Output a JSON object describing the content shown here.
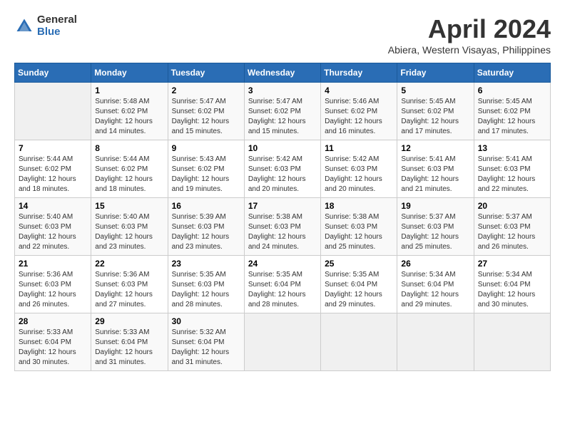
{
  "logo": {
    "general": "General",
    "blue": "Blue"
  },
  "title": "April 2024",
  "subtitle": "Abiera, Western Visayas, Philippines",
  "headers": [
    "Sunday",
    "Monday",
    "Tuesday",
    "Wednesday",
    "Thursday",
    "Friday",
    "Saturday"
  ],
  "weeks": [
    [
      {
        "day": "",
        "info": ""
      },
      {
        "day": "1",
        "info": "Sunrise: 5:48 AM\nSunset: 6:02 PM\nDaylight: 12 hours\nand 14 minutes."
      },
      {
        "day": "2",
        "info": "Sunrise: 5:47 AM\nSunset: 6:02 PM\nDaylight: 12 hours\nand 15 minutes."
      },
      {
        "day": "3",
        "info": "Sunrise: 5:47 AM\nSunset: 6:02 PM\nDaylight: 12 hours\nand 15 minutes."
      },
      {
        "day": "4",
        "info": "Sunrise: 5:46 AM\nSunset: 6:02 PM\nDaylight: 12 hours\nand 16 minutes."
      },
      {
        "day": "5",
        "info": "Sunrise: 5:45 AM\nSunset: 6:02 PM\nDaylight: 12 hours\nand 17 minutes."
      },
      {
        "day": "6",
        "info": "Sunrise: 5:45 AM\nSunset: 6:02 PM\nDaylight: 12 hours\nand 17 minutes."
      }
    ],
    [
      {
        "day": "7",
        "info": "Sunrise: 5:44 AM\nSunset: 6:02 PM\nDaylight: 12 hours\nand 18 minutes."
      },
      {
        "day": "8",
        "info": "Sunrise: 5:44 AM\nSunset: 6:02 PM\nDaylight: 12 hours\nand 18 minutes."
      },
      {
        "day": "9",
        "info": "Sunrise: 5:43 AM\nSunset: 6:02 PM\nDaylight: 12 hours\nand 19 minutes."
      },
      {
        "day": "10",
        "info": "Sunrise: 5:42 AM\nSunset: 6:03 PM\nDaylight: 12 hours\nand 20 minutes."
      },
      {
        "day": "11",
        "info": "Sunrise: 5:42 AM\nSunset: 6:03 PM\nDaylight: 12 hours\nand 20 minutes."
      },
      {
        "day": "12",
        "info": "Sunrise: 5:41 AM\nSunset: 6:03 PM\nDaylight: 12 hours\nand 21 minutes."
      },
      {
        "day": "13",
        "info": "Sunrise: 5:41 AM\nSunset: 6:03 PM\nDaylight: 12 hours\nand 22 minutes."
      }
    ],
    [
      {
        "day": "14",
        "info": "Sunrise: 5:40 AM\nSunset: 6:03 PM\nDaylight: 12 hours\nand 22 minutes."
      },
      {
        "day": "15",
        "info": "Sunrise: 5:40 AM\nSunset: 6:03 PM\nDaylight: 12 hours\nand 23 minutes."
      },
      {
        "day": "16",
        "info": "Sunrise: 5:39 AM\nSunset: 6:03 PM\nDaylight: 12 hours\nand 23 minutes."
      },
      {
        "day": "17",
        "info": "Sunrise: 5:38 AM\nSunset: 6:03 PM\nDaylight: 12 hours\nand 24 minutes."
      },
      {
        "day": "18",
        "info": "Sunrise: 5:38 AM\nSunset: 6:03 PM\nDaylight: 12 hours\nand 25 minutes."
      },
      {
        "day": "19",
        "info": "Sunrise: 5:37 AM\nSunset: 6:03 PM\nDaylight: 12 hours\nand 25 minutes."
      },
      {
        "day": "20",
        "info": "Sunrise: 5:37 AM\nSunset: 6:03 PM\nDaylight: 12 hours\nand 26 minutes."
      }
    ],
    [
      {
        "day": "21",
        "info": "Sunrise: 5:36 AM\nSunset: 6:03 PM\nDaylight: 12 hours\nand 26 minutes."
      },
      {
        "day": "22",
        "info": "Sunrise: 5:36 AM\nSunset: 6:03 PM\nDaylight: 12 hours\nand 27 minutes."
      },
      {
        "day": "23",
        "info": "Sunrise: 5:35 AM\nSunset: 6:03 PM\nDaylight: 12 hours\nand 28 minutes."
      },
      {
        "day": "24",
        "info": "Sunrise: 5:35 AM\nSunset: 6:04 PM\nDaylight: 12 hours\nand 28 minutes."
      },
      {
        "day": "25",
        "info": "Sunrise: 5:35 AM\nSunset: 6:04 PM\nDaylight: 12 hours\nand 29 minutes."
      },
      {
        "day": "26",
        "info": "Sunrise: 5:34 AM\nSunset: 6:04 PM\nDaylight: 12 hours\nand 29 minutes."
      },
      {
        "day": "27",
        "info": "Sunrise: 5:34 AM\nSunset: 6:04 PM\nDaylight: 12 hours\nand 30 minutes."
      }
    ],
    [
      {
        "day": "28",
        "info": "Sunrise: 5:33 AM\nSunset: 6:04 PM\nDaylight: 12 hours\nand 30 minutes."
      },
      {
        "day": "29",
        "info": "Sunrise: 5:33 AM\nSunset: 6:04 PM\nDaylight: 12 hours\nand 31 minutes."
      },
      {
        "day": "30",
        "info": "Sunrise: 5:32 AM\nSunset: 6:04 PM\nDaylight: 12 hours\nand 31 minutes."
      },
      {
        "day": "",
        "info": ""
      },
      {
        "day": "",
        "info": ""
      },
      {
        "day": "",
        "info": ""
      },
      {
        "day": "",
        "info": ""
      }
    ]
  ]
}
